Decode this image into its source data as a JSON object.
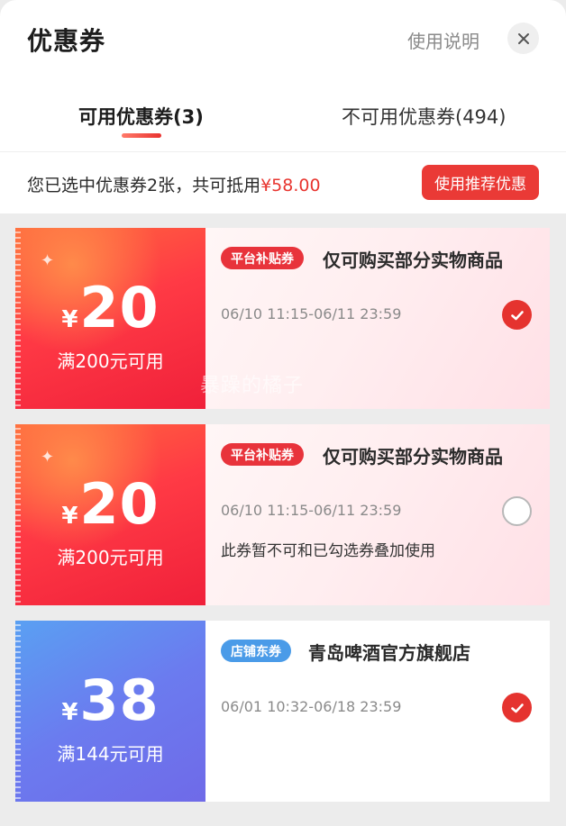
{
  "header": {
    "title": "优惠券",
    "help_label": "使用说明",
    "close_icon": "close-icon"
  },
  "tabs": [
    {
      "label": "可用优惠券(3)",
      "active": true
    },
    {
      "label": "不可用优惠券(494)",
      "active": false
    }
  ],
  "summary": {
    "text_prefix": "您已选中优惠券2张，共可抵用",
    "amount": "¥58.00",
    "button_label": "使用推荐优惠"
  },
  "coupons": [
    {
      "currency": "¥",
      "value": "20",
      "threshold": "满200元可用",
      "badge": "平台补贴券",
      "title": "仅可购买部分实物商品",
      "validity": "06/10 11:15-06/11 23:59",
      "note": "",
      "selected": true,
      "theme": "red"
    },
    {
      "currency": "¥",
      "value": "20",
      "threshold": "满200元可用",
      "badge": "平台补贴券",
      "title": "仅可购买部分实物商品",
      "validity": "06/10 11:15-06/11 23:59",
      "note": "此券暂不可和已勾选券叠加使用",
      "selected": false,
      "theme": "red"
    },
    {
      "currency": "¥",
      "value": "38",
      "threshold": "满144元可用",
      "badge": "店铺东券",
      "title": "青岛啤酒官方旗舰店",
      "validity": "06/01 10:32-06/18 23:59",
      "note": "",
      "selected": true,
      "theme": "blue"
    }
  ],
  "watermark": "暴躁的橘子",
  "colors": {
    "accent_red": "#e8352f",
    "badge_blue": "#4a9be8"
  }
}
